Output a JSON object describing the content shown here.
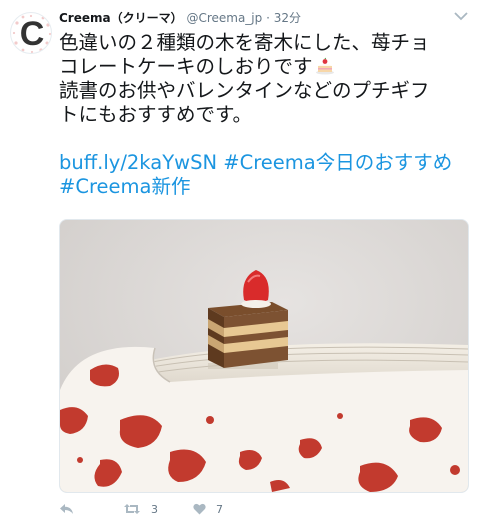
{
  "user": {
    "avatar_letter": "C",
    "name": "Creema（クリーマ）",
    "handle": "@Creema_jp",
    "separator": "·",
    "time": "32分"
  },
  "tweet": {
    "lines": [
      "色違いの２種類の木を寄木にした、苺チョ",
      "コレートケーキのしおりです",
      "読書のお供やバレンタインなどのプチギフ",
      "トにもおすすめです。"
    ],
    "link_url": "buff.ly/2kaYwSN",
    "hashtag_1": "#Creema今日のおすすめ",
    "hashtag_2": "#Creema新作",
    "emoji": "cake-emoji"
  },
  "actions": {
    "reply_icon": "reply-icon",
    "retweet_icon": "retweet-icon",
    "retweet_count": "3",
    "like_icon": "heart-icon",
    "like_count": "7"
  },
  "colors": {
    "link": "#1b95e0",
    "text": "#14171a",
    "muted": "#657786",
    "action_icon": "#aab8c2"
  }
}
